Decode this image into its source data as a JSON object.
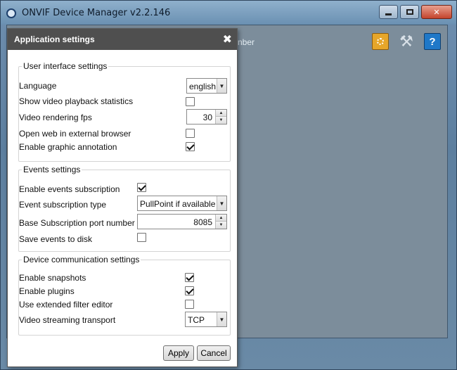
{
  "window": {
    "title": "ONVIF Device Manager v2.2.146",
    "background_text": "nber",
    "icons": [
      "app-logo-icon",
      "configure-icon",
      "tools-icon",
      "help-icon"
    ]
  },
  "dialog": {
    "title": "Application settings",
    "close_glyph": "✖",
    "ui_group": {
      "title": "User interface settings",
      "language_label": "Language",
      "language_value": "english",
      "stats_label": "Show video playback statistics",
      "stats_checked": false,
      "fps_label": "Video rendering fps",
      "fps_value": "30",
      "web_label": "Open web in external browser",
      "web_checked": false,
      "annotation_label": "Enable graphic annotation",
      "annotation_checked": true
    },
    "events_group": {
      "title": "Events settings",
      "subscription_label": "Enable events subscription",
      "subscription_checked": true,
      "type_label": "Event subscription type",
      "type_value": "PullPoint if available",
      "port_label": "Base Subscription port number",
      "port_value": "8085",
      "save_label": "Save events to disk",
      "save_checked": false
    },
    "comm_group": {
      "title": "Device communication settings",
      "snapshots_label": "Enable snapshots",
      "snapshots_checked": true,
      "plugins_label": "Enable plugins",
      "plugins_checked": true,
      "filter_label": "Use extended filter editor",
      "filter_checked": false,
      "transport_label": "Video streaming transport",
      "transport_value": "TCP"
    },
    "buttons": {
      "apply": "Apply",
      "cancel": "Cancel"
    }
  }
}
